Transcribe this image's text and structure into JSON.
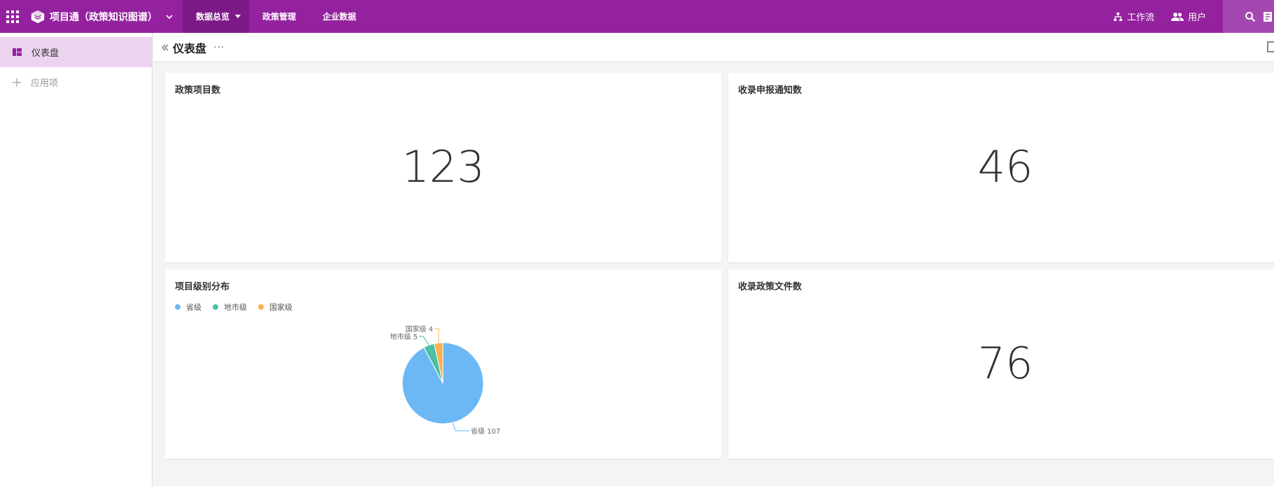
{
  "topbar": {
    "app_title": "项目通（政策知识图谱）",
    "nav": [
      {
        "label": "数据总览",
        "active": true
      },
      {
        "label": "政策管理"
      },
      {
        "label": "企业数据"
      }
    ],
    "workflow_label": "工作流",
    "users_label": "用户",
    "accent_color": "#94229f"
  },
  "sidebar": {
    "items": [
      {
        "label": "仪表盘",
        "active": true,
        "icon": "dashboard-icon"
      },
      {
        "label": "应用项",
        "icon": "plus-icon"
      }
    ]
  },
  "page": {
    "title": "仪表盘",
    "more": "···"
  },
  "cards": {
    "policy_projects": {
      "title": "政策项目数",
      "value": "123"
    },
    "notices": {
      "title": "收录申报通知数",
      "value": "46"
    },
    "level_distribution": {
      "title": "项目级别分布"
    },
    "policy_files": {
      "title": "收录政策文件数",
      "value": "76"
    }
  },
  "chart_data": {
    "type": "pie",
    "title": "项目级别分布",
    "legend_position": "top-left",
    "series": [
      {
        "name": "省级",
        "value": 107,
        "color": "#6cb8f5"
      },
      {
        "name": "地市级",
        "value": 5,
        "color": "#4cbfa6"
      },
      {
        "name": "国家级",
        "value": 4,
        "color": "#fbb24e"
      }
    ]
  }
}
